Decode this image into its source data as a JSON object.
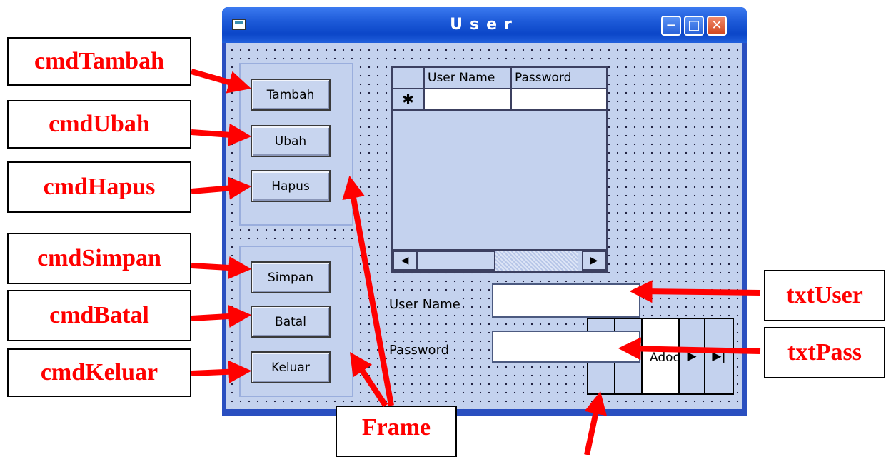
{
  "window": {
    "title": "User",
    "buttons": {
      "minimize": "−",
      "maximize": "□",
      "close": "✕"
    }
  },
  "buttons": {
    "tambah": "Tambah",
    "ubah": "Ubah",
    "hapus": "Hapus",
    "simpan": "Simpan",
    "batal": "Batal",
    "keluar": "Keluar"
  },
  "grid": {
    "columns": [
      "User Name",
      "Password"
    ],
    "new_row_marker": "✱",
    "scroll_left": "◀",
    "scroll_right": "▶"
  },
  "form": {
    "user_label": "User Name",
    "user_value": "",
    "pass_label": "Password",
    "pass_value": ""
  },
  "adodc": {
    "caption": "Adoc",
    "next": "▶",
    "last": "▶|"
  },
  "callouts": {
    "cmdTambah": "cmdTambah",
    "cmdUbah": "cmdUbah",
    "cmdHapus": "cmdHapus",
    "cmdSimpan": "cmdSimpan",
    "cmdBatal": "cmdBatal",
    "cmdKeluar": "cmdKeluar",
    "txtUser": "txtUser",
    "txtPass": "txtPass",
    "frame": "Frame"
  },
  "colors": {
    "arrow": "#ff0000",
    "callout_text": "#ff0000",
    "titlebar": "#0b46c8",
    "form_background": "#c4d2ee"
  }
}
